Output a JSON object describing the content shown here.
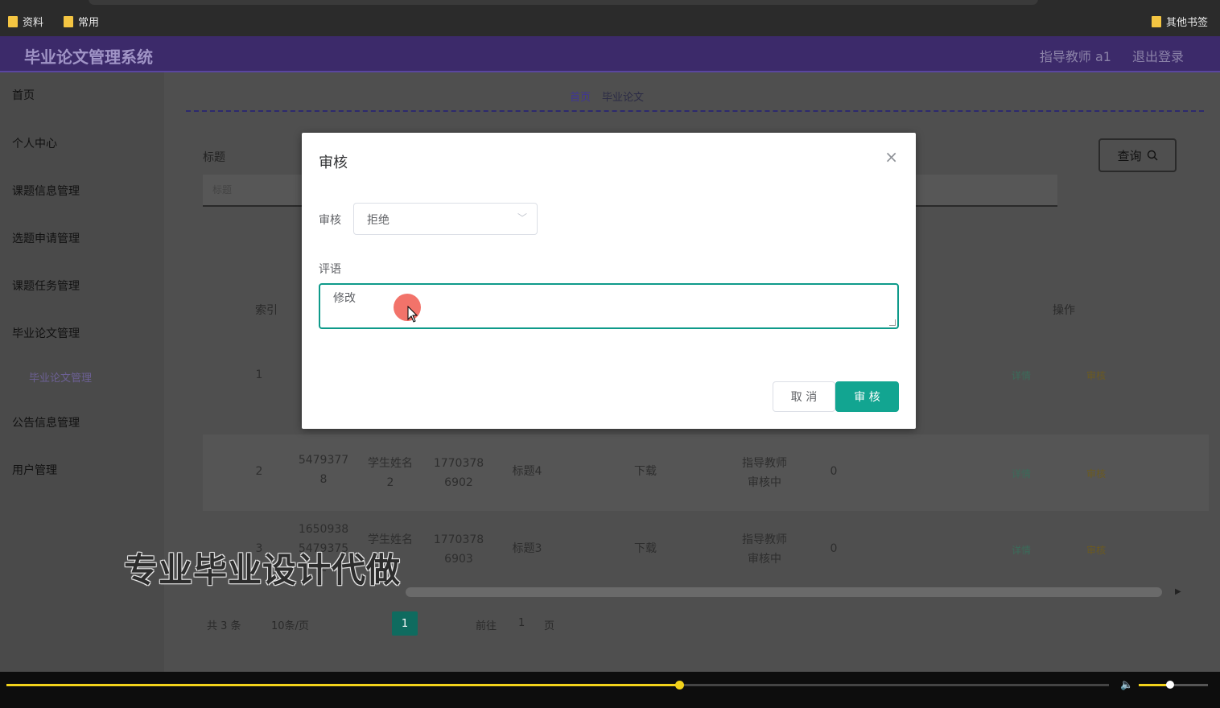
{
  "bookmarks": {
    "items": [
      "资料",
      "常用"
    ],
    "other": "其他书签"
  },
  "app": {
    "title": "毕业论文管理系统",
    "user": "指导教师 a1",
    "logout": "退出登录"
  },
  "sidebar": {
    "items": [
      "首页",
      "个人中心",
      "课题信息管理",
      "选题申请管理",
      "课题任务管理",
      "毕业论文管理",
      "公告信息管理",
      "用户管理"
    ],
    "sub_active": "毕业论文管理"
  },
  "breadcrumb": {
    "home": "首页",
    "current": "毕业论文"
  },
  "search": {
    "title_label": "标题",
    "placeholder": "标题",
    "query_button": "查询"
  },
  "table": {
    "headers": {
      "index": "索引",
      "ops": "操作"
    },
    "rows": [
      {
        "index": "1",
        "thesis_no": "",
        "student": "",
        "student_no": "",
        "title": "",
        "download": "",
        "status": "",
        "score": ""
      },
      {
        "index": "2",
        "thesis_no": "5479377 8",
        "student": "学生姓名 2",
        "student_no": "1770378 6902",
        "title": "标题4",
        "download": "下载",
        "status": "指导教师 审核中",
        "score": "0"
      },
      {
        "index": "3",
        "thesis_no": "1650938 5479375 2",
        "student": "学生姓名 3",
        "student_no": "1770378 6903",
        "title": "标题3",
        "download": "下载",
        "status": "指导教师 审核中",
        "score": "0"
      }
    ],
    "op_detail": "详情",
    "op_review": "审核"
  },
  "pager": {
    "total": "共 3 条",
    "size": "10条/页",
    "current": "1",
    "goto": "前往",
    "goto_val": "1",
    "page_unit": "页"
  },
  "watermark": "专业毕业设计代做",
  "modal": {
    "title": "审核",
    "review_label": "审核",
    "review_value": "拒绝",
    "comment_label": "评语",
    "comment_value": "修改",
    "cancel": "取 消",
    "confirm": "审 核"
  },
  "player": {
    "progress": 0.61,
    "volume": 0.45
  },
  "colors": {
    "accent": "#12a591",
    "topbar": "#3c2a6a",
    "progress": "#f2d21b"
  }
}
